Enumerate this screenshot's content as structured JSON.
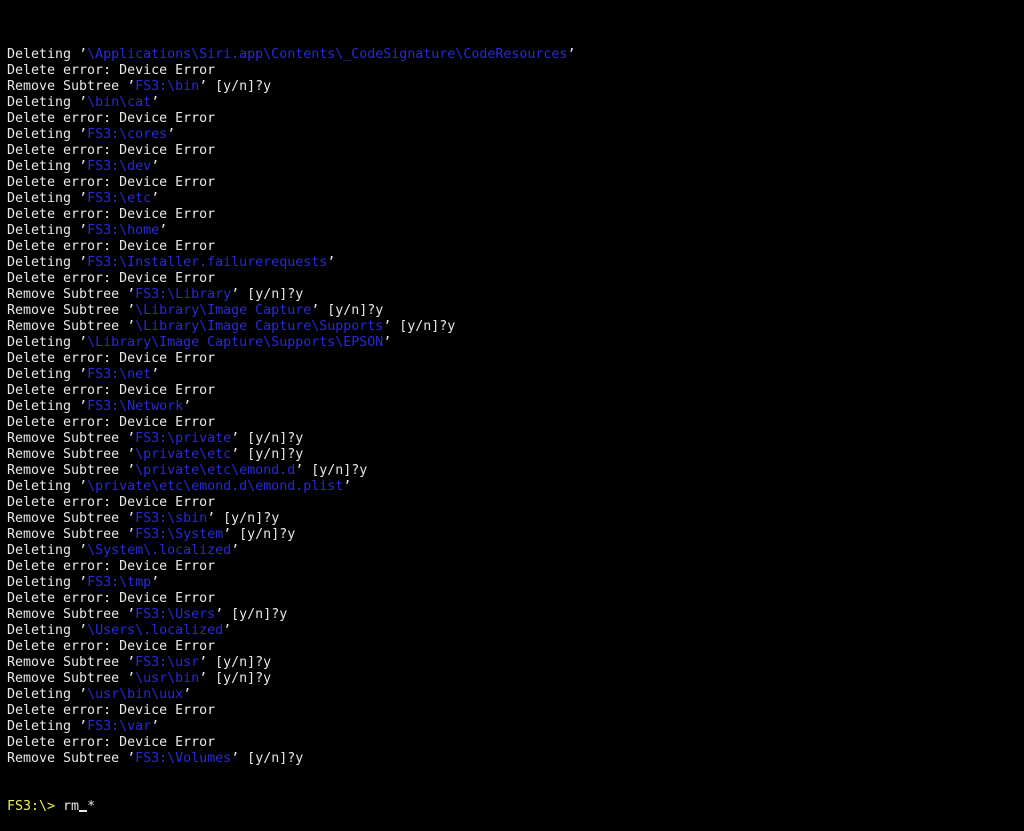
{
  "colors": {
    "background": "#000000",
    "text": "#e8e8e8",
    "path": "#2a2ad8",
    "prompt": "#f0f050"
  },
  "lines": [
    {
      "prefix": "Deleting ’",
      "path": "\\Applications\\Siri.app\\Contents\\_CodeSignature\\CodeResources",
      "suffix": "’"
    },
    {
      "prefix": "Delete error: Device Error",
      "path": "",
      "suffix": ""
    },
    {
      "prefix": "Remove Subtree ’",
      "path": "FS3:\\bin",
      "suffix": "’ [y/n]?y"
    },
    {
      "prefix": "Deleting ’",
      "path": "\\bin\\cat",
      "suffix": "’"
    },
    {
      "prefix": "Delete error: Device Error",
      "path": "",
      "suffix": ""
    },
    {
      "prefix": "Deleting ’",
      "path": "FS3:\\cores",
      "suffix": "’"
    },
    {
      "prefix": "Delete error: Device Error",
      "path": "",
      "suffix": ""
    },
    {
      "prefix": "Deleting ’",
      "path": "FS3:\\dev",
      "suffix": "’"
    },
    {
      "prefix": "Delete error: Device Error",
      "path": "",
      "suffix": ""
    },
    {
      "prefix": "Deleting ’",
      "path": "FS3:\\etc",
      "suffix": "’"
    },
    {
      "prefix": "Delete error: Device Error",
      "path": "",
      "suffix": ""
    },
    {
      "prefix": "Deleting ’",
      "path": "FS3:\\home",
      "suffix": "’"
    },
    {
      "prefix": "Delete error: Device Error",
      "path": "",
      "suffix": ""
    },
    {
      "prefix": "Deleting ’",
      "path": "FS3:\\Installer.failurerequests",
      "suffix": "’"
    },
    {
      "prefix": "Delete error: Device Error",
      "path": "",
      "suffix": ""
    },
    {
      "prefix": "Remove Subtree ’",
      "path": "FS3:\\Library",
      "suffix": "’ [y/n]?y"
    },
    {
      "prefix": "Remove Subtree ’",
      "path": "\\Library\\Image Capture",
      "suffix": "’ [y/n]?y"
    },
    {
      "prefix": "Remove Subtree ’",
      "path": "\\Library\\Image Capture\\Supports",
      "suffix": "’ [y/n]?y"
    },
    {
      "prefix": "Deleting ’",
      "path": "\\Library\\Image Capture\\Supports\\EPSON",
      "suffix": "’"
    },
    {
      "prefix": "Delete error: Device Error",
      "path": "",
      "suffix": ""
    },
    {
      "prefix": "Deleting ’",
      "path": "FS3:\\net",
      "suffix": "’"
    },
    {
      "prefix": "Delete error: Device Error",
      "path": "",
      "suffix": ""
    },
    {
      "prefix": "Deleting ’",
      "path": "FS3:\\Network",
      "suffix": "’"
    },
    {
      "prefix": "Delete error: Device Error",
      "path": "",
      "suffix": ""
    },
    {
      "prefix": "Remove Subtree ’",
      "path": "FS3:\\private",
      "suffix": "’ [y/n]?y"
    },
    {
      "prefix": "Remove Subtree ’",
      "path": "\\private\\etc",
      "suffix": "’ [y/n]?y"
    },
    {
      "prefix": "Remove Subtree ’",
      "path": "\\private\\etc\\emond.d",
      "suffix": "’ [y/n]?y"
    },
    {
      "prefix": "Deleting ’",
      "path": "\\private\\etc\\emond.d\\emond.plist",
      "suffix": "’"
    },
    {
      "prefix": "Delete error: Device Error",
      "path": "",
      "suffix": ""
    },
    {
      "prefix": "Remove Subtree ’",
      "path": "FS3:\\sbin",
      "suffix": "’ [y/n]?y"
    },
    {
      "prefix": "Remove Subtree ’",
      "path": "FS3:\\System",
      "suffix": "’ [y/n]?y"
    },
    {
      "prefix": "Deleting ’",
      "path": "\\System\\.localized",
      "suffix": "’"
    },
    {
      "prefix": "Delete error: Device Error",
      "path": "",
      "suffix": ""
    },
    {
      "prefix": "Deleting ’",
      "path": "FS3:\\tmp",
      "suffix": "’"
    },
    {
      "prefix": "Delete error: Device Error",
      "path": "",
      "suffix": ""
    },
    {
      "prefix": "Remove Subtree ’",
      "path": "FS3:\\Users",
      "suffix": "’ [y/n]?y"
    },
    {
      "prefix": "Deleting ’",
      "path": "\\Users\\.localized",
      "suffix": "’"
    },
    {
      "prefix": "Delete error: Device Error",
      "path": "",
      "suffix": ""
    },
    {
      "prefix": "Remove Subtree ’",
      "path": "FS3:\\usr",
      "suffix": "’ [y/n]?y"
    },
    {
      "prefix": "Remove Subtree ’",
      "path": "\\usr\\bin",
      "suffix": "’ [y/n]?y"
    },
    {
      "prefix": "Deleting ’",
      "path": "\\usr\\bin\\uux",
      "suffix": "’"
    },
    {
      "prefix": "Delete error: Device Error",
      "path": "",
      "suffix": ""
    },
    {
      "prefix": "Deleting ’",
      "path": "FS3:\\var",
      "suffix": "’"
    },
    {
      "prefix": "Delete error: Device Error",
      "path": "",
      "suffix": ""
    },
    {
      "prefix": "Remove Subtree ’",
      "path": "FS3:\\Volumes",
      "suffix": "’ [y/n]?y"
    }
  ],
  "prompt": {
    "label": "FS3:\\> ",
    "command": "rm *"
  }
}
